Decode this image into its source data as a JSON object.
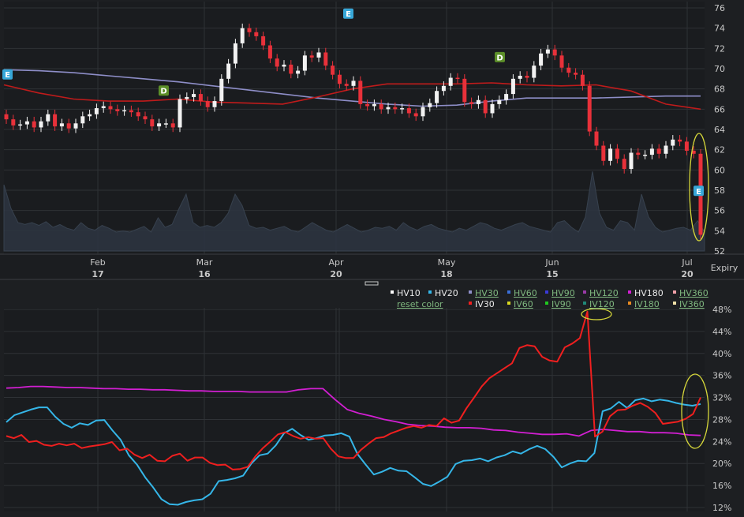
{
  "chart_data": [
    {
      "type": "candlestick",
      "title": "",
      "ylim": [
        52,
        76
      ],
      "y_ticks": [
        "76",
        "74",
        "72",
        "70",
        "68",
        "66",
        "64",
        "62",
        "60",
        "58",
        "56",
        "54",
        "52"
      ],
      "x_ticks": [
        {
          "month": "Feb",
          "day": "17"
        },
        {
          "month": "Mar",
          "day": "16"
        },
        {
          "month": "Apr",
          "day": "20"
        },
        {
          "month": "May",
          "day": "18"
        },
        {
          "month": "Jun",
          "day": "15"
        },
        {
          "month": "Jul",
          "day": "20"
        }
      ],
      "expiry_label": "Expiry",
      "price_close": [
        65.0,
        64.4,
        64.5,
        64.8,
        64.2,
        64.8,
        65.5,
        64.3,
        64.6,
        64.1,
        64.6,
        65.3,
        65.5,
        66.1,
        66.3,
        66.0,
        65.8,
        65.9,
        65.7,
        65.3,
        65.0,
        64.3,
        64.6,
        64.6,
        64.2,
        67.0,
        67.2,
        67.5,
        66.8,
        66.2,
        66.8,
        69.0,
        70.5,
        72.5,
        74.0,
        73.6,
        73.2,
        72.3,
        71.0,
        70.2,
        70.4,
        69.5,
        69.8,
        71.3,
        71.1,
        71.6,
        70.3,
        69.4,
        68.5,
        68.3,
        68.8,
        66.5,
        66.3,
        66.5,
        66.0,
        66.2,
        66.0,
        66.1,
        65.6,
        65.3,
        66.2,
        66.6,
        67.8,
        68.3,
        69.1,
        69.0,
        66.7,
        66.5,
        66.9,
        65.6,
        66.5,
        66.9,
        67.5,
        69.0,
        69.3,
        69.1,
        70.3,
        71.5,
        71.9,
        71.3,
        70.1,
        69.6,
        69.4,
        68.3,
        63.8,
        62.4,
        60.9,
        62.1,
        61.1,
        60.1,
        61.7,
        61.5,
        61.5,
        62.1,
        61.6,
        62.4,
        63.0,
        62.8,
        61.9,
        61.6,
        53.6
      ],
      "earnings_markers": [
        {
          "label": "E",
          "kind": "earnings"
        },
        {
          "label": "D",
          "kind": "dividend"
        },
        {
          "label": "E",
          "kind": "earnings"
        },
        {
          "label": "D",
          "kind": "dividend"
        },
        {
          "label": "E",
          "kind": "earnings"
        }
      ],
      "series": [
        {
          "name": "MA long",
          "color": "#8e8ec8",
          "values": [
            69.9,
            69.8,
            69.6,
            69.3,
            69.0,
            68.7,
            68.3,
            67.9,
            67.5,
            67.1,
            66.8,
            66.5,
            66.3,
            66.4,
            66.8,
            67.1,
            67.1,
            67.1,
            67.2,
            67.3,
            67.3
          ]
        },
        {
          "name": "MA short",
          "color": "#c01b1b",
          "values": [
            68.4,
            67.6,
            67.0,
            66.8,
            66.8,
            67.0,
            66.7,
            66.6,
            66.5,
            67.2,
            68.0,
            68.5,
            68.5,
            68.5,
            68.6,
            68.4,
            68.3,
            68.4,
            67.8,
            66.5,
            66.0
          ]
        }
      ],
      "volume_relative": [
        0.7,
        0.45,
        0.3,
        0.28,
        0.3,
        0.27,
        0.31,
        0.25,
        0.28,
        0.24,
        0.22,
        0.3,
        0.24,
        0.22,
        0.27,
        0.24,
        0.2,
        0.21,
        0.2,
        0.23,
        0.26,
        0.2,
        0.35,
        0.25,
        0.28,
        0.45,
        0.6,
        0.3,
        0.25,
        0.27,
        0.25,
        0.3,
        0.4,
        0.6,
        0.48,
        0.27,
        0.24,
        0.25,
        0.22,
        0.24,
        0.26,
        0.22,
        0.2,
        0.25,
        0.3,
        0.26,
        0.22,
        0.2,
        0.24,
        0.28,
        0.24,
        0.2,
        0.22,
        0.25,
        0.24,
        0.26,
        0.22,
        0.3,
        0.25,
        0.22,
        0.26,
        0.28,
        0.24,
        0.22,
        0.2,
        0.24,
        0.22,
        0.26,
        0.3,
        0.28,
        0.24,
        0.22,
        0.25,
        0.28,
        0.3,
        0.26,
        0.24,
        0.22,
        0.2,
        0.3,
        0.32,
        0.25,
        0.2,
        0.36,
        0.84,
        0.4,
        0.25,
        0.22,
        0.32,
        0.3,
        0.22,
        0.6,
        0.36,
        0.25,
        0.2,
        0.22,
        0.24,
        0.25,
        0.22,
        0.32,
        0.2
      ]
    },
    {
      "type": "line",
      "title": "",
      "ylim": [
        12,
        48
      ],
      "y_ticks": [
        "48%",
        "44%",
        "40%",
        "36%",
        "32%",
        "28%",
        "24%",
        "20%",
        "16%",
        "12%"
      ],
      "series": [
        {
          "name": "HV20",
          "color": "#35b6e8",
          "values": [
            27.5,
            28.8,
            29.3,
            29.8,
            30.2,
            30.2,
            28.5,
            27.2,
            26.5,
            27.3,
            27.0,
            27.8,
            27.9,
            26.0,
            24.3,
            21.5,
            19.8,
            17.5,
            15.6,
            13.5,
            12.6,
            12.5,
            13.0,
            13.3,
            13.5,
            14.5,
            16.8,
            17.0,
            17.3,
            17.8,
            20.0,
            21.5,
            21.8,
            23.3,
            25.5,
            26.3,
            25.2,
            24.3,
            24.6,
            25.1,
            25.2,
            25.5,
            24.9,
            21.7,
            19.8,
            18.0,
            18.5,
            19.2,
            18.7,
            18.6,
            17.5,
            16.3,
            15.9,
            16.7,
            17.6,
            19.9,
            20.5,
            20.6,
            20.9,
            20.4,
            21.1,
            21.5,
            22.2,
            21.8,
            22.6,
            23.2,
            22.6,
            21.2,
            19.3,
            20.0,
            20.5,
            20.4,
            21.9,
            29.5,
            30.0,
            31.2,
            30.1,
            31.5,
            31.8,
            31.3,
            31.6,
            31.4,
            31.0,
            30.7,
            30.5,
            30.8
          ]
        },
        {
          "name": "IV30",
          "color": "#f01f1f",
          "values": [
            25.0,
            24.6,
            25.2,
            23.9,
            24.1,
            23.4,
            23.2,
            23.6,
            23.3,
            23.6,
            22.8,
            23.1,
            23.3,
            23.5,
            23.9,
            22.4,
            22.7,
            21.6,
            21.0,
            21.6,
            20.5,
            20.4,
            21.4,
            21.8,
            20.5,
            21.1,
            21.1,
            20.1,
            19.7,
            19.8,
            18.9,
            19.0,
            19.4,
            21.3,
            22.8,
            24.0,
            25.3,
            25.7,
            25.0,
            24.5,
            24.8,
            24.5,
            24.6,
            22.7,
            21.3,
            21.0,
            21.0,
            22.5,
            23.6,
            24.6,
            24.8,
            25.5,
            26.0,
            26.5,
            26.8,
            26.5,
            27.0,
            26.8,
            28.2,
            27.4,
            27.8,
            30.1,
            32.0,
            34.0,
            35.5,
            36.4,
            37.3,
            38.2,
            41.0,
            41.5,
            41.3,
            39.4,
            38.7,
            38.5,
            41.1,
            41.8,
            42.8,
            47.6,
            24.9,
            25.8,
            28.6,
            29.7,
            29.8,
            30.5,
            31.0,
            30.3,
            29.2,
            27.2,
            27.4,
            27.6,
            28.1,
            29.0,
            32.0
          ]
        },
        {
          "name": "HV180",
          "color": "#d21fd2",
          "values": [
            33.7,
            33.8,
            34.0,
            34.0,
            33.9,
            33.8,
            33.8,
            33.7,
            33.6,
            33.6,
            33.5,
            33.5,
            33.4,
            33.4,
            33.3,
            33.2,
            33.2,
            33.1,
            33.1,
            33.1,
            33.0,
            33.0,
            33.0,
            33.0,
            33.4,
            33.6,
            33.6,
            31.6,
            29.8,
            29.1,
            28.6,
            28.0,
            27.6,
            27.1,
            26.9,
            26.8,
            26.6,
            26.5,
            26.5,
            26.4,
            26.1,
            26.0,
            25.7,
            25.5,
            25.3,
            25.3,
            25.4,
            25.0,
            26.0,
            26.2,
            26.0,
            25.8,
            25.8,
            25.6,
            25.6,
            25.5,
            25.2,
            25.1
          ]
        }
      ]
    }
  ],
  "legend": {
    "reset_label": "reset color",
    "items": [
      {
        "label": "HV10",
        "active": true,
        "swatch": "#ffffff"
      },
      {
        "label": "HV20",
        "active": true,
        "swatch": "#35b6e8"
      },
      {
        "label": "HV30",
        "active": false,
        "swatch": "#8e8ec8"
      },
      {
        "label": "HV60",
        "active": false,
        "swatch": "#3a6fd8"
      },
      {
        "label": "HV90",
        "active": false,
        "swatch": "#3a3ad8"
      },
      {
        "label": "HV120",
        "active": false,
        "swatch": "#9a3aa8"
      },
      {
        "label": "HV180",
        "active": true,
        "swatch": "#d21fd2"
      },
      {
        "label": "HV360",
        "active": false,
        "swatch": "#f0a0a8"
      },
      {
        "label": "IV30",
        "active": true,
        "swatch": "#f01f1f"
      },
      {
        "label": "IV60",
        "active": false,
        "swatch": "#d8d820"
      },
      {
        "label": "IV90",
        "active": false,
        "swatch": "#20c820"
      },
      {
        "label": "IV120",
        "active": false,
        "swatch": "#208878"
      },
      {
        "label": "IV180",
        "active": false,
        "swatch": "#e88a20"
      },
      {
        "label": "IV360",
        "active": false,
        "swatch": "#f0e0a8"
      }
    ]
  },
  "colors": {
    "background": "#1d1f22",
    "grid": "#2f3236",
    "up_candle": "#f2f2f2",
    "down_candle": "#e8313a",
    "earnings_badge": "#37a7d8",
    "dividend_badge": "#5c8f29",
    "annotation_ellipse": "#d7d83a",
    "axis_text": "#c8c8c8"
  }
}
